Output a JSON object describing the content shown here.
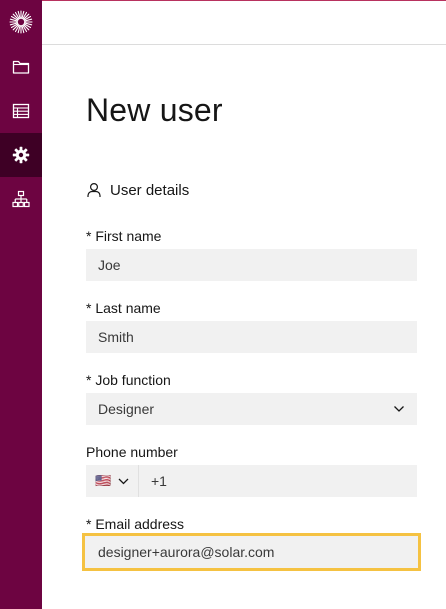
{
  "page": {
    "title": "New user"
  },
  "sidebar": {
    "items": [
      {
        "name": "logo",
        "icon": "sunburst-logo-icon"
      },
      {
        "name": "files",
        "icon": "folder-icon"
      },
      {
        "name": "table",
        "icon": "table-icon"
      },
      {
        "name": "settings",
        "icon": "gear-icon",
        "active": true
      },
      {
        "name": "hierarchy",
        "icon": "hierarchy-icon"
      }
    ]
  },
  "section": {
    "title": "User details",
    "icon": "user-icon"
  },
  "form": {
    "first_name": {
      "label": "* First name",
      "value": "Joe"
    },
    "last_name": {
      "label": "* Last name",
      "value": "Smith"
    },
    "job_function": {
      "label": "* Job function",
      "value": "Designer"
    },
    "phone": {
      "label": "Phone number",
      "country_flag": "🇺🇸",
      "value": "+1"
    },
    "email": {
      "label": "* Email address",
      "value": "designer+aurora@solar.com"
    }
  },
  "colors": {
    "sidebar_bg": "#6d0441",
    "sidebar_active": "#3e0025",
    "field_bg": "#f1f1f1",
    "highlight": "#f5c242"
  }
}
